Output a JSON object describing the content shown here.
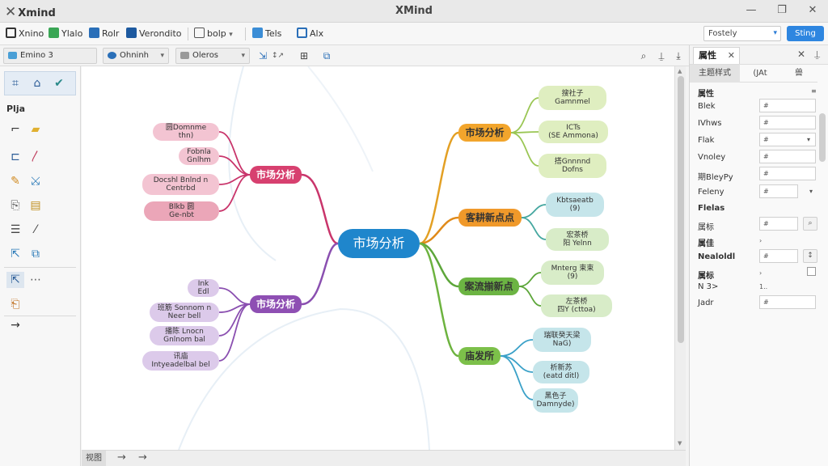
{
  "titlebar": {
    "logo": "Xmind",
    "title": "XMind",
    "minimize": "—",
    "restore": "❐",
    "close": "✕"
  },
  "menubar": {
    "items": [
      "Xnino",
      "Ylalo",
      "Rolr",
      "Verondito",
      "bolp",
      "Tels",
      "Alx"
    ],
    "search_value": "Fostely",
    "setting_label": "Sting"
  },
  "toolbar2": {
    "style_select": "Emino 3",
    "font_select": "Ohninh",
    "theme_select": "Oleros"
  },
  "leftbar": {
    "label": "Plja"
  },
  "mindmap": {
    "center": "市场分析",
    "left_branches": [
      {
        "label": "市场分析",
        "color": "#c9356b",
        "children": [
          "圆Domnme\nthn)",
          "Fobnla\nGnlhm",
          "Docshl Bnlnd n\nCentrbd",
          "Blkb 圆\nGe-nbt"
        ]
      },
      {
        "label": "市场分析",
        "color": "#8a4fb0",
        "children": [
          "Ink\nEdl",
          "班筋 Sonnom n\nNeer bell",
          "播陈 Lnocn\nGnlnom bal",
          "讯庙\nIntyeadelbal bel"
        ]
      }
    ],
    "right_branches": [
      {
        "label": "市场分析",
        "color": "#e3a024",
        "children": [
          "搜社子\nGamnmel",
          "ICTs\n(SE Ammona)",
          "搭Gnnnnd\nDofns"
        ]
      },
      {
        "label": "客耕新点点",
        "color": "#e08a1a",
        "children": [
          "Kbtsaeatb\n(9)",
          "宏茶桥\n阳 Yelnn"
        ]
      },
      {
        "label": "案流揃新点",
        "color": "#5da63a",
        "children": [
          "Mnterg 束束\n(9)",
          "左茶桥\n四Y (cttoa)"
        ]
      },
      {
        "label": "庙发所",
        "color": "#6db33f",
        "children": [
          "瑞联癸天梁\nNaG)",
          "析新苏\n(eatd ditl)",
          "黑色子\nDamnyde)"
        ]
      }
    ]
  },
  "statusbar": {
    "label": "视图"
  },
  "rpanel": {
    "tab": "属性",
    "subtabs": [
      "主题样式",
      "(JAt",
      "兽"
    ],
    "section1": "属性",
    "rows1": [
      {
        "label": "Blek",
        "value": "#",
        "control": ""
      },
      {
        "label": "IVhws",
        "value": "#",
        "control": ""
      },
      {
        "label": "Flak",
        "value": "#",
        "control": "▾"
      },
      {
        "label": "Vnoley",
        "value": "#",
        "control": ""
      },
      {
        "label": "期BleyPy",
        "value": "#",
        "control": ""
      },
      {
        "label": "Feleny",
        "value": "#",
        "control": "▾"
      }
    ],
    "section2": "Flelas",
    "rows2": [
      {
        "label": "属标",
        "value": "#"
      },
      {
        "label": "属佳",
        "value": ""
      },
      {
        "label": "Nealoldl",
        "value": "#"
      },
      {
        "label": "属标",
        "value": ""
      },
      {
        "label": "N 3>",
        "value": "1.."
      },
      {
        "label": "Jadr",
        "value": "#"
      }
    ]
  }
}
